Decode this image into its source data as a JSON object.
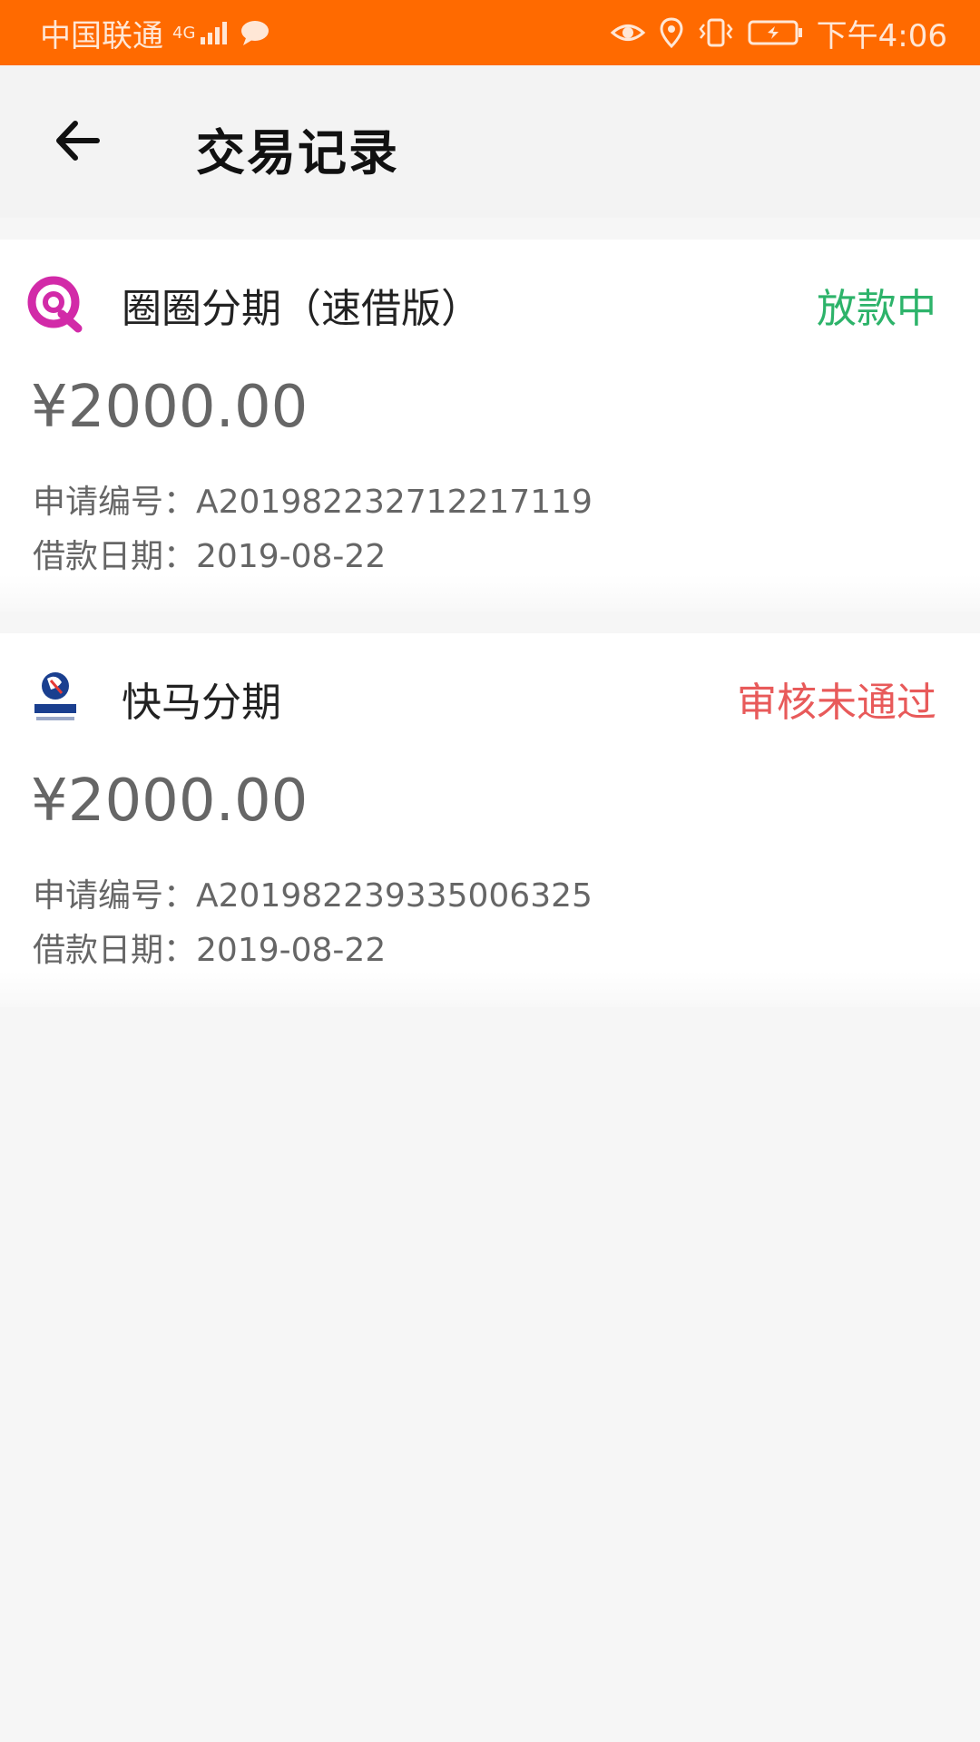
{
  "status_bar": {
    "carrier": "中国联通",
    "network": "4G",
    "time": "下午4:06"
  },
  "header": {
    "title": "交易记录"
  },
  "records": [
    {
      "product": "圈圈分期（速借版）",
      "status": "放款中",
      "status_color": "#2db36a",
      "amount": "¥2000.00",
      "application_label": "申请编号：",
      "application_no": "A201982232712217119",
      "date_label": "借款日期：",
      "date": "2019-08-22",
      "logo_icon": "quanquan-logo-icon"
    },
    {
      "product": "快马分期",
      "status": "审核未通过",
      "status_color": "#e85a5a",
      "amount": "¥2000.00",
      "application_label": "申请编号：",
      "application_no": "A201982239335006325",
      "date_label": "借款日期：",
      "date": "2019-08-22",
      "logo_icon": "kuaima-logo-icon"
    }
  ],
  "colors": {
    "status_bar": "#ff6a00",
    "background": "#f6f6f6"
  }
}
